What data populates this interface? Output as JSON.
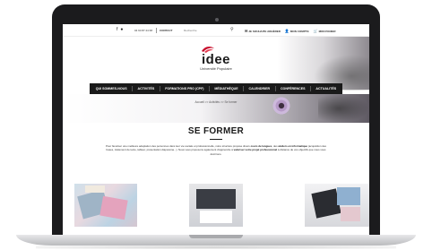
{
  "topbar": {
    "social": [
      "f",
      "●"
    ],
    "phone": "04 93 87 24 68",
    "contact": "CONTACT",
    "search_placeholder": "Recherche",
    "links": [
      {
        "icon": "✉",
        "label": "JE SOUHAITE ADHÉRER"
      },
      {
        "icon": "👤",
        "label": "MON COMPTE"
      },
      {
        "icon": "🛒",
        "label": "MON PANIER"
      }
    ]
  },
  "header": {
    "logo_text": "idee",
    "logo_subtitle": "Université Populaire"
  },
  "nav": {
    "items": [
      "QUI SOMMES-NOUS",
      "ACTIVITÉS",
      "FORMATIONS PRO (CPF)",
      "MÉDIATHÈQUE",
      "CALENDRIER",
      "CONFÉRENCES",
      "ACTUALITÉS"
    ]
  },
  "breadcrumb": "Accueil >> Activités >> Se former",
  "main": {
    "title": "SE FORMER",
    "intro_1": "Pour favoriser une meilleure adaptation des personnes dans leur vie sociale et professionnelle, notre structure propose divers ",
    "intro_bold_1": "cours de langues",
    "intro_2": ", des ",
    "intro_bold_2": "ateliers en informatique",
    "intro_3": " (acquisition des bases, traitement de texte, tableur, présentation diaporama...). Nous vous proposons également d'apprendre à ",
    "intro_bold_3": "valoriser votre projet professionnel",
    "intro_4": " à distance de vos objectifs que nous vous décrirons."
  },
  "colors": {
    "accent_red": "#c8102e",
    "nav_bg": "#1a1a1a"
  }
}
